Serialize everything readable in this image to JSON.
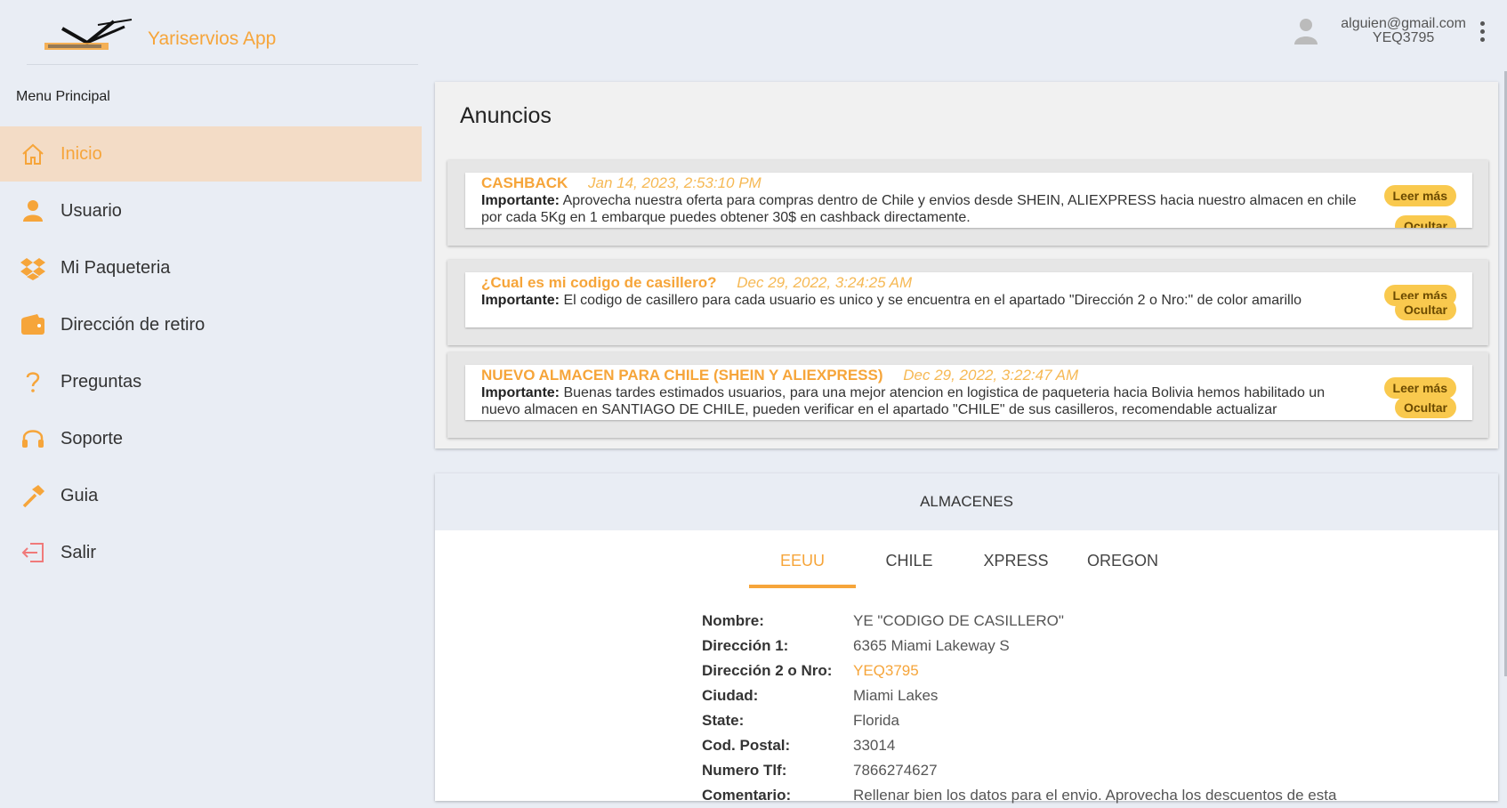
{
  "app": {
    "name": "Yariservios App",
    "logo_text": "YARISERVIOS"
  },
  "user": {
    "email": "alguien@gmail.com",
    "code": "YEQ3795"
  },
  "sidebar": {
    "title": "Menu Principal",
    "items": [
      {
        "label": "Inicio",
        "icon": "home-icon"
      },
      {
        "label": "Usuario",
        "icon": "user-icon"
      },
      {
        "label": "Mi Paqueteria",
        "icon": "dropbox-icon"
      },
      {
        "label": "Dirección de retiro",
        "icon": "wallet-icon"
      },
      {
        "label": "Preguntas",
        "icon": "question-icon"
      },
      {
        "label": "Soporte",
        "icon": "headset-icon"
      },
      {
        "label": "Guia",
        "icon": "hammer-icon"
      },
      {
        "label": "Salir",
        "icon": "logout-icon"
      }
    ]
  },
  "announcements": {
    "title": "Anuncios",
    "more_label": "Leer más",
    "hide_label": "Ocultar",
    "items": [
      {
        "title": "CASHBACK",
        "date": "Jan 14, 2023, 2:53:10 PM",
        "body_label": "Importante:",
        "body": "Aprovecha nuestra oferta para compras dentro de Chile y envios desde SHEIN, ALIEXPRESS hacia nuestro almacen en chile por cada 5Kg en 1 embarque puedes obtener 30$ en cashback directamente."
      },
      {
        "title": "¿Cual es mi codigo de casillero?",
        "date": "Dec 29, 2022, 3:24:25 AM",
        "body_label": "Importante:",
        "body": "El codigo de casillero para cada usuario es unico y se encuentra en el apartado \"Dirección 2 o Nro:\" de color amarillo"
      },
      {
        "title": "NUEVO ALMACEN PARA CHILE (SHEIN Y ALIEXPRESS)",
        "date": "Dec 29, 2022, 3:22:47 AM",
        "body_label": "Importante:",
        "body": "Buenas tardes estimados usuarios, para una mejor atencion en logistica de paqueteria hacia Bolivia hemos habilitado un nuevo almacen en SANTIAGO DE CHILE, pueden verificar en el apartado \"CHILE\" de sus casilleros, recomendable actualizar"
      }
    ]
  },
  "warehouses": {
    "title": "ALMACENES",
    "tabs": [
      "EEUU",
      "CHILE",
      "XPRESS",
      "OREGON"
    ],
    "active_tab": 0,
    "fields": [
      {
        "label": "Nombre:",
        "value": "YE \"CODIGO DE CASILLERO\""
      },
      {
        "label": "Dirección 1:",
        "value": "6365 Miami Lakeway S"
      },
      {
        "label": "Dirección 2 o Nro:",
        "value": "YEQ3795",
        "highlight": true
      },
      {
        "label": "Ciudad:",
        "value": "Miami Lakes"
      },
      {
        "label": "State:",
        "value": "Florida"
      },
      {
        "label": "Cod. Postal:",
        "value": "33014"
      },
      {
        "label": "Numero Tlf:",
        "value": "7866274627"
      },
      {
        "label": "Comentario:",
        "value": "Rellenar bien los datos para el envio. Aprovecha los descuentos de esta"
      }
    ]
  },
  "colors": {
    "accent": "#f6a53a",
    "active_bg": "#f3dcc6",
    "pill": "#f9c94e",
    "page_bg": "#e9edf4"
  }
}
